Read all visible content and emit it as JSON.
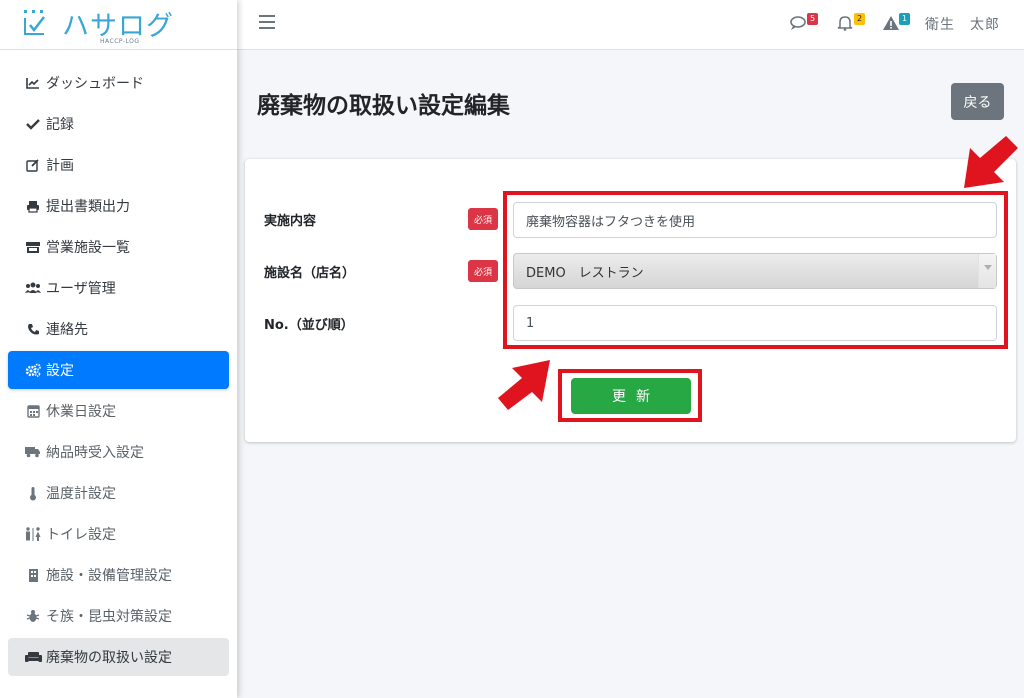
{
  "brand": {
    "title": "ハサログ",
    "subtitle": "HACCP-LOG",
    "accent_color": "#3aa6d8"
  },
  "sidebar": {
    "items": [
      {
        "label": "ダッシュボード",
        "icon": "chart-line-icon"
      },
      {
        "label": "記録",
        "icon": "check-icon"
      },
      {
        "label": "計画",
        "icon": "edit-icon"
      },
      {
        "label": "提出書類出力",
        "icon": "print-icon"
      },
      {
        "label": "営業施設一覧",
        "icon": "store-icon"
      },
      {
        "label": "ユーザ管理",
        "icon": "users-icon"
      },
      {
        "label": "連絡先",
        "icon": "phone-icon"
      },
      {
        "label": "設定",
        "icon": "cogs-icon",
        "state": "active"
      },
      {
        "label": "休業日設定",
        "icon": "calendar-icon"
      },
      {
        "label": "納品時受入設定",
        "icon": "truck-icon"
      },
      {
        "label": "温度計設定",
        "icon": "thermometer-icon"
      },
      {
        "label": "トイレ設定",
        "icon": "restroom-icon"
      },
      {
        "label": "施設・設備管理設定",
        "icon": "building-icon"
      },
      {
        "label": "そ族・昆虫対策設定",
        "icon": "bug-icon"
      },
      {
        "label": "廃棄物の取扱い設定",
        "icon": "couch-icon",
        "state": "current"
      }
    ],
    "active_color": "#007bff"
  },
  "topbar": {
    "comments_count": "5",
    "notifications_count": "2",
    "alerts_count": "1",
    "user_name": "衛生　太郎",
    "badge_colors": {
      "comments": "#dc3545",
      "notifications": "#ffc107",
      "alerts": "#17a2b8"
    }
  },
  "page": {
    "title": "廃棄物の取扱い設定編集",
    "back_label": "戻る"
  },
  "form": {
    "required_label": "必須",
    "fields": [
      {
        "label": "実施内容",
        "value": "廃棄物容器はフタつきを使用",
        "required": true,
        "type": "text"
      },
      {
        "label": "施設名（店名）",
        "value": "DEMO　レストラン",
        "required": true,
        "type": "select"
      },
      {
        "label": "No.（並び順）",
        "value": "1",
        "required": false,
        "type": "text"
      }
    ],
    "submit_label": "更新",
    "submit_color": "#28a745"
  },
  "annotation": {
    "highlight_color": "#e0141e"
  }
}
